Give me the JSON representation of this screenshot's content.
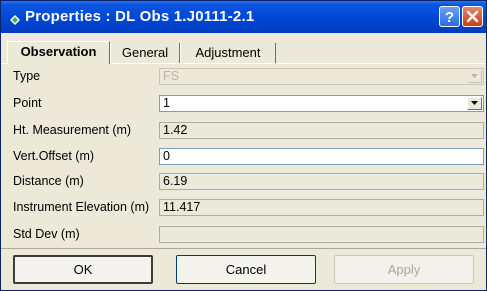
{
  "window": {
    "title": "Properties : DL Obs 1.J0111-2.1"
  },
  "titlebar_buttons": {
    "help_icon": "help-icon",
    "close_icon": "close-icon"
  },
  "tabs": [
    {
      "label": "Observation",
      "active": true
    },
    {
      "label": "General",
      "active": false
    },
    {
      "label": "Adjustment",
      "active": false
    }
  ],
  "fields": {
    "type": {
      "label": "Type",
      "value": "FS"
    },
    "point": {
      "label": "Point",
      "value": "1"
    },
    "ht_measurement": {
      "label": "Ht. Measurement (m)",
      "value": "1.42"
    },
    "vert_offset": {
      "label": "Vert.Offset (m)",
      "value": "0"
    },
    "distance": {
      "label": "Distance (m)",
      "value": "6.19"
    },
    "instrument_elevation": {
      "label": "Instrument Elevation (m)",
      "value": "11.417"
    },
    "std_dev": {
      "label": "Std Dev (m)",
      "value": ""
    }
  },
  "buttons": {
    "ok": "OK",
    "cancel": "Cancel",
    "apply": "Apply"
  }
}
